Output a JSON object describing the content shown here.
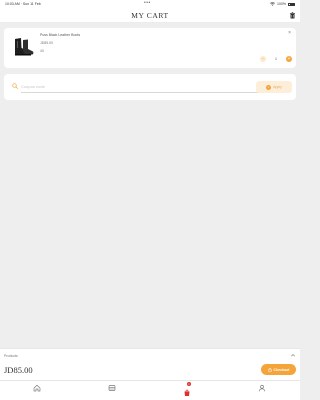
{
  "status_bar": {
    "time": "10:03 AM · Sun 11 Feb",
    "battery": "100%"
  },
  "header": {
    "title": "MY CART",
    "trash_icon": "trash-icon"
  },
  "cart": {
    "items": [
      {
        "name": "Puss Black Leather Boots",
        "price": "JD85.00",
        "size": "40",
        "quantity": "1"
      }
    ]
  },
  "coupon": {
    "placeholder": "Coupon code",
    "value": "",
    "apply_label": "Apply"
  },
  "summary": {
    "products_label": "Products",
    "total": "JD85.00",
    "checkout_label": "Checkout"
  },
  "tab_bar": {
    "cart_badge": "1",
    "items": [
      "home-icon",
      "catalog-icon",
      "cart-icon",
      "profile-icon"
    ]
  },
  "colors": {
    "accent": "#f5a43a",
    "accent_light": "#fdeed9",
    "badge": "#e0302a",
    "background": "#eeeeef"
  }
}
